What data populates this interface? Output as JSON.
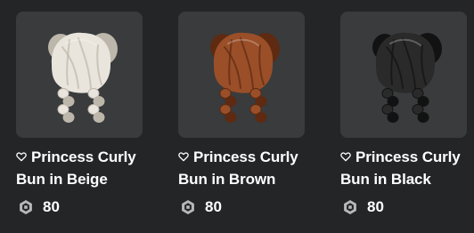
{
  "items": [
    {
      "name": "Princess Curly Bun in Beige",
      "price": "80",
      "hair_color": "#e9e4dc",
      "hair_shade": "#bdb6ab"
    },
    {
      "name": "Princess Curly Bun in Brown",
      "price": "80",
      "hair_color": "#9a4f28",
      "hair_shade": "#5e2a12"
    },
    {
      "name": "Princess Curly Bun in Black",
      "price": "80",
      "hair_color": "#2a2a2a",
      "hair_shade": "#121212"
    }
  ],
  "icons": {
    "favorite": "heart-outline-icon",
    "currency": "robux-icon"
  },
  "colors": {
    "background": "#232527",
    "thumbnail_bg": "#393b3d",
    "text": "#ffffff"
  }
}
